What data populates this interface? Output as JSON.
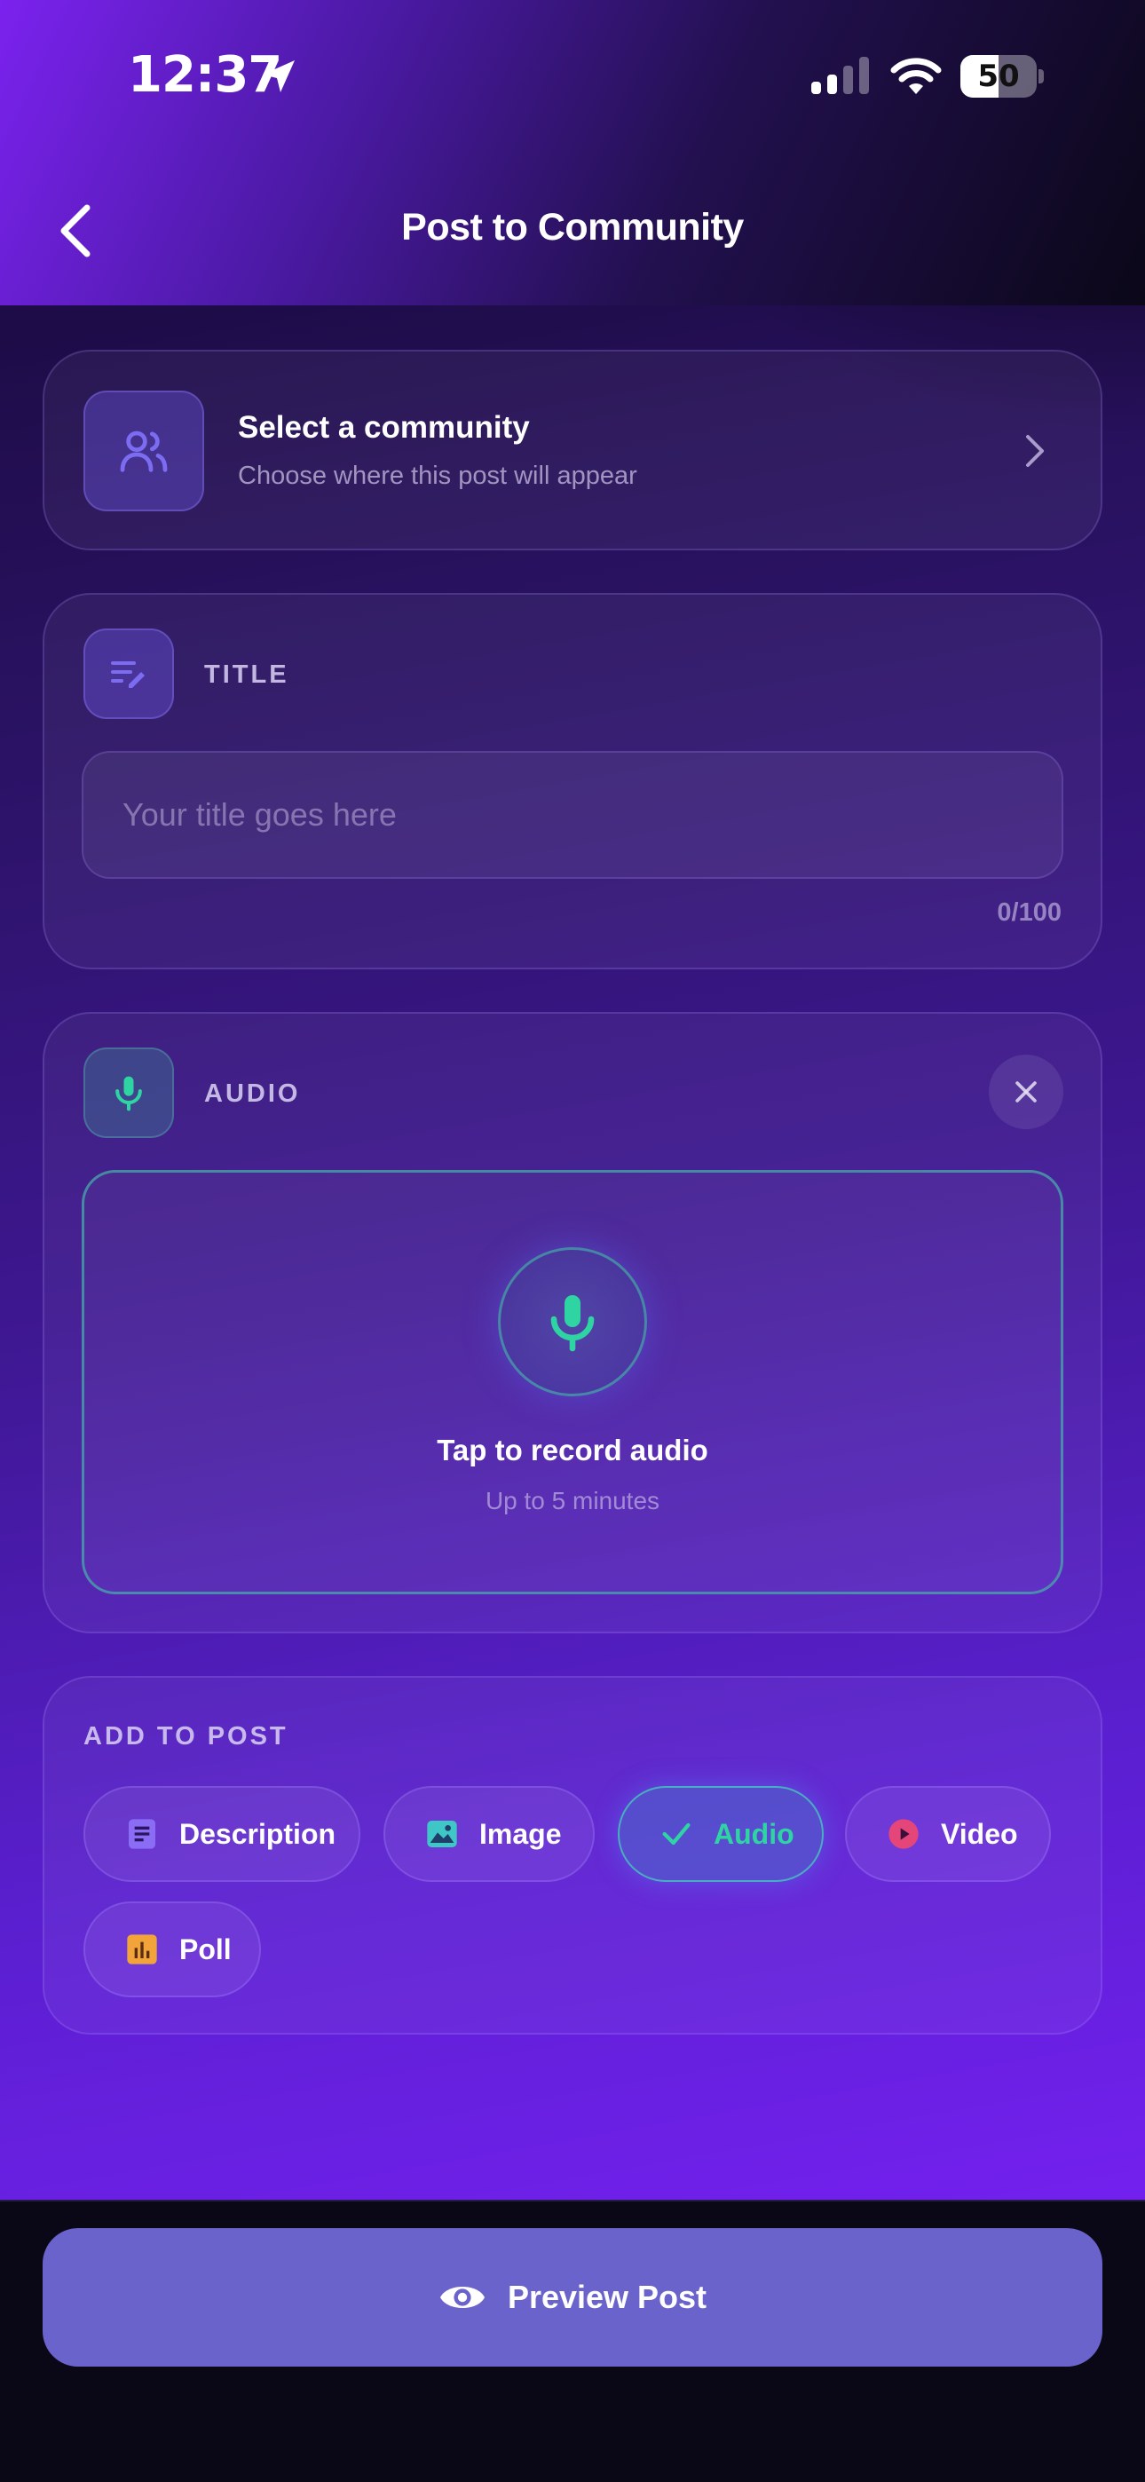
{
  "status_bar": {
    "time": "12:37",
    "battery": "50",
    "battery_level": 0.5
  },
  "header": {
    "title": "Post to Community"
  },
  "community": {
    "title": "Select a community",
    "subtitle": "Choose where this post will appear"
  },
  "title_section": {
    "label": "TITLE",
    "placeholder": "Your title goes here",
    "value": "",
    "char_count": "0/100"
  },
  "audio_section": {
    "label": "AUDIO",
    "record_title": "Tap to record audio",
    "record_subtitle": "Up to 5 minutes"
  },
  "add_to_post": {
    "label": "ADD TO POST",
    "chips": [
      {
        "label": "Description",
        "icon": "description-icon",
        "active": false
      },
      {
        "label": "Image",
        "icon": "image-icon",
        "active": false
      },
      {
        "label": "Audio",
        "icon": "check-icon",
        "active": true
      },
      {
        "label": "Video",
        "icon": "play-icon",
        "active": false
      },
      {
        "label": "Poll",
        "icon": "poll-icon",
        "active": false
      }
    ]
  },
  "footer": {
    "preview_label": "Preview Post"
  },
  "colors": {
    "accent_green": "#2fd4a3",
    "accent_purple": "#6b63cc",
    "icon_purple": "#7b6cf2"
  }
}
